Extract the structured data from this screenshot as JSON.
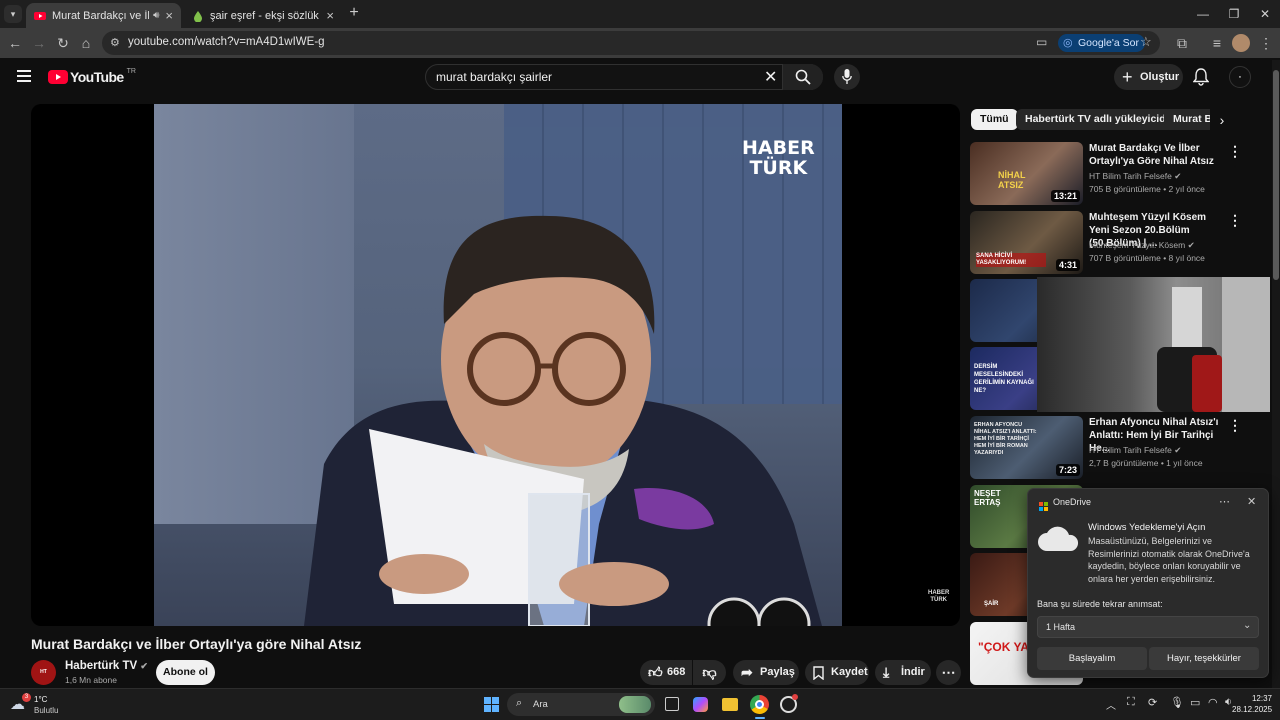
{
  "browser": {
    "tabs": [
      {
        "title": "Murat Bardakçı ve İlber Ortaylı'ya göre Nihal Atsız",
        "active": true,
        "muted_icon": "speaker-icon"
      },
      {
        "title": "şair eşref - ekşi sözlük",
        "active": false
      }
    ],
    "url": "youtube.com/watch?v=mA4D1wIWE-g",
    "google_sor_label": "Google'a Sor"
  },
  "youtube": {
    "logo_text": "YouTube",
    "logo_region": "TR",
    "search_query": "murat bardakçı şairler",
    "create_label": "Oluştur"
  },
  "player": {
    "watermark_top": "HABER",
    "watermark_bottom": "TÜRK",
    "corner_top": "HABER",
    "corner_bottom": "TÜRK"
  },
  "video": {
    "title": "Murat Bardakçı ve İlber Ortaylı'ya göre Nihal Atsız",
    "channel": "Habertürk TV",
    "subscribers": "1,6 Mn abone",
    "subscribe_label": "Abone ol",
    "likes": "668",
    "share_label": "Paylaş",
    "save_label": "Kaydet",
    "download_label": "İndir"
  },
  "sidebar": {
    "chips": [
      "Tümü",
      "Habertürk TV adlı yükleyiciden",
      "Murat B"
    ],
    "recommendations": [
      {
        "title": "Murat Bardakçı Ve İlber Ortaylı'ya Göre Nihal Atsız",
        "channel": "HT Bilim Tarih Felsefe",
        "meta": "705 B görüntüleme • 2 yıl önce",
        "duration": "13:21",
        "thumb_text": "NİHAL ATSIZ"
      },
      {
        "title": "Muhteşem Yüzyıl Kösem Yeni Sezon 20.Bölüm (50.Bölüm) | ...",
        "channel": "Muhteşem Yüzyıl: Kösem",
        "meta": "707 B görüntüleme • 8 yıl önce",
        "duration": "4:31",
        "thumb_text": "SANA HİCİVİ YASAKLIYORUM!"
      },
      {
        "title": "",
        "channel": "",
        "meta": "",
        "duration": "",
        "thumb_text": ""
      },
      {
        "title": "",
        "channel": "",
        "meta": "",
        "duration": "",
        "thumb_text": "DERSİM MESELESİNDEKİ GERİLİMİN KAYNAĞI NE?"
      },
      {
        "title": "Erhan Afyoncu Nihal Atsız'ı Anlattı: Hem İyi Bir Tarihçi He...",
        "channel": "HT Bilim Tarih Felsefe",
        "meta": "2,7 B görüntüleme • 1 yıl önce",
        "duration": "7:23",
        "thumb_text": "ERHAN AFYONCU NİHAL ATSIZ'I ANLATTI: HEM İYİ BİR TARİHÇİ HEM İYİ BİR ROMAN YAZARIYDI"
      },
      {
        "title": "",
        "channel": "",
        "meta": "",
        "duration": "",
        "thumb_text": "NEŞET ERTAŞ"
      },
      {
        "title": "",
        "channel": "",
        "meta": "",
        "duration": "",
        "thumb_text": "ŞAİR"
      },
      {
        "title": "",
        "channel": "",
        "meta": "",
        "duration": "",
        "thumb_text": "\"ÇOK YA"
      }
    ]
  },
  "onedrive": {
    "app": "OneDrive",
    "heading": "Windows Yedekleme'yi Açın",
    "body": "Masaüstünüzü, Belgelerinizi ve Resimlerinizi otomatik olarak OneDrive'a kaydedin, böylece onları koruyabilir ve onlara her yerden erişebilirsiniz.",
    "remind_label": "Bana şu sürede tekrar anımsat:",
    "remind_value": "1 Hafta",
    "primary_label": "Başlayalım",
    "secondary_label": "Hayır, teşekkürler"
  },
  "taskbar": {
    "weather_temp": "1°C",
    "weather_desc": "Bulutlu",
    "search_label": "Ara",
    "time": "12:37",
    "date": "28.12.2025"
  },
  "colors": {
    "yt_red": "#ff0033",
    "bg": "#0f0f0f",
    "chip_active_bg": "#f1f1f1",
    "onedrive_bg": "#2b2b2b"
  }
}
